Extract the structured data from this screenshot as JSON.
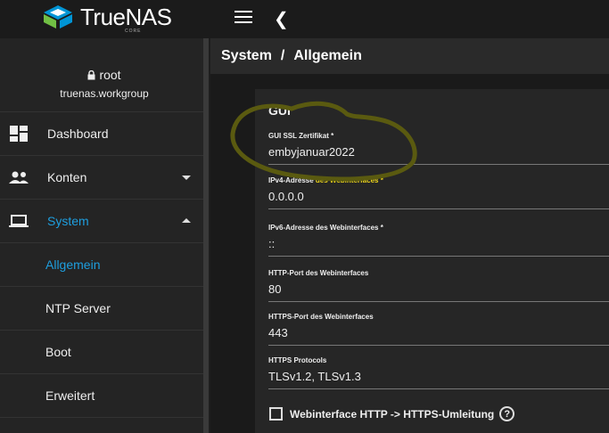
{
  "brand": {
    "name_true": "True",
    "name_nas": "NAS",
    "sub": "CORE"
  },
  "user": {
    "name": "root",
    "host": "truenas.workgroup"
  },
  "sidebar": {
    "items": [
      {
        "label": "Dashboard"
      },
      {
        "label": "Konten"
      },
      {
        "label": "System"
      }
    ],
    "subitems": [
      {
        "label": "Allgemein"
      },
      {
        "label": "NTP Server"
      },
      {
        "label": "Boot"
      },
      {
        "label": "Erweitert"
      }
    ]
  },
  "breadcrumb": {
    "root": "System",
    "sep": "/",
    "current": "Allgemein"
  },
  "card": {
    "title": "GUI",
    "fields": [
      {
        "label": "GUI SSL Zertifikat *",
        "value": "embyjanuar2022"
      },
      {
        "label": "IPv4-Adresse des Webinterfaces *",
        "value": "0.0.0.0"
      },
      {
        "label": "IPv6-Adresse des Webinterfaces *",
        "value": "::"
      },
      {
        "label": "HTTP-Port des Webinterfaces",
        "value": "80"
      },
      {
        "label": "HTTPS-Port des Webinterfaces",
        "value": "443"
      },
      {
        "label": "HTTPS Protocols",
        "value": "TLSv1.2, TLSv1.3"
      }
    ],
    "ipv4_label_part1": "IPv4-Adresse ",
    "ipv4_label_part2": "des Webinterfaces *",
    "checkbox_label": "Webinterface HTTP -> HTTPS-Umleitung",
    "help_glyph": "?"
  },
  "colors": {
    "accent": "#1e9ede",
    "highlight": "#eed61a"
  }
}
